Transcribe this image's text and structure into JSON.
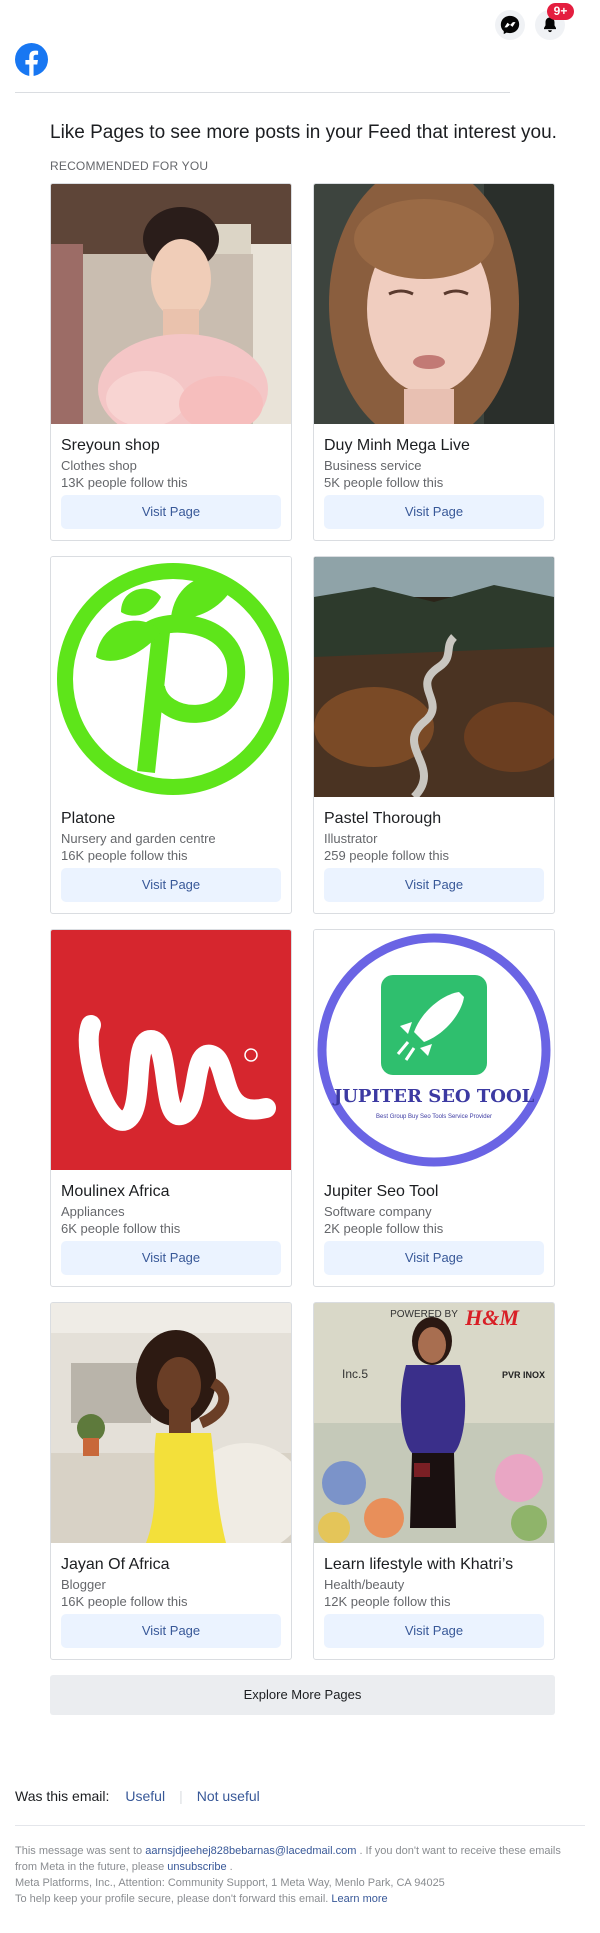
{
  "header": {
    "notification_badge": "9+",
    "brand_color": "#1877f2",
    "badge_color": "#e41e3f"
  },
  "intro": {
    "headline": "Like Pages to see more posts in your Feed that interest you.",
    "section_label": "RECOMMENDED FOR YOU"
  },
  "pages": [
    {
      "name": "Sreyoun shop",
      "category": "Clothes shop",
      "followers": "13K people follow this",
      "button": "Visit Page",
      "image": "woman-portrait-pink-dress"
    },
    {
      "name": "Duy Minh Mega Live",
      "category": "Business service",
      "followers": "5K people follow this",
      "button": "Visit Page",
      "image": "woman-portrait-closeup"
    },
    {
      "name": "Platone",
      "category": "Nursery and garden centre",
      "followers": "16K people follow this",
      "button": "Visit Page",
      "image": "green-p-leaf-logo"
    },
    {
      "name": "Pastel Thorough",
      "category": "Illustrator",
      "followers": "259 people follow this",
      "button": "Visit Page",
      "image": "winding-forest-road"
    },
    {
      "name": "Moulinex Africa",
      "category": "Appliances",
      "followers": "6K people follow this",
      "button": "Visit Page",
      "image": "moulinex-logo"
    },
    {
      "name": "Jupiter Seo Tool",
      "category": "Software company",
      "followers": "2K people follow this",
      "button": "Visit Page",
      "image": "rocket-logo"
    },
    {
      "name": "Jayan Of Africa",
      "category": "Blogger",
      "followers": "16K people follow this",
      "button": "Visit Page",
      "image": "woman-yellow-dress"
    },
    {
      "name": "Learn lifestyle with Khatri’s",
      "category": "Health/beauty",
      "followers": "12K people follow this",
      "button": "Visit Page",
      "image": "woman-event-backdrop"
    }
  ],
  "logos": {
    "jupiter_title": "JUPITER SEO TOOL",
    "jupiter_tagline": "Best Group Buy Seo Tools Service Provider",
    "backdrop_powered": "POWERED BY",
    "backdrop_brand": "H&M",
    "backdrop_left": "Inc.5",
    "backdrop_right": "PVR INOX"
  },
  "explore_button": "Explore More Pages",
  "feedback": {
    "question": "Was this email:",
    "useful": "Useful",
    "not_useful": "Not useful"
  },
  "footer": {
    "line1_pre": "This message was sent to",
    "email": "aarnsjdjeehej828bebarnas@lacedmail.com",
    "line1_post": ". If you don't want to receive these emails from Meta in the future, please",
    "unsubscribe": "unsubscribe",
    "line1_end": ".",
    "address": "Meta Platforms, Inc., Attention: Community Support, 1 Meta Way, Menlo Park, CA 94025",
    "security": "To help keep your profile secure, please don't forward this email.",
    "learn_more": "Learn more"
  }
}
